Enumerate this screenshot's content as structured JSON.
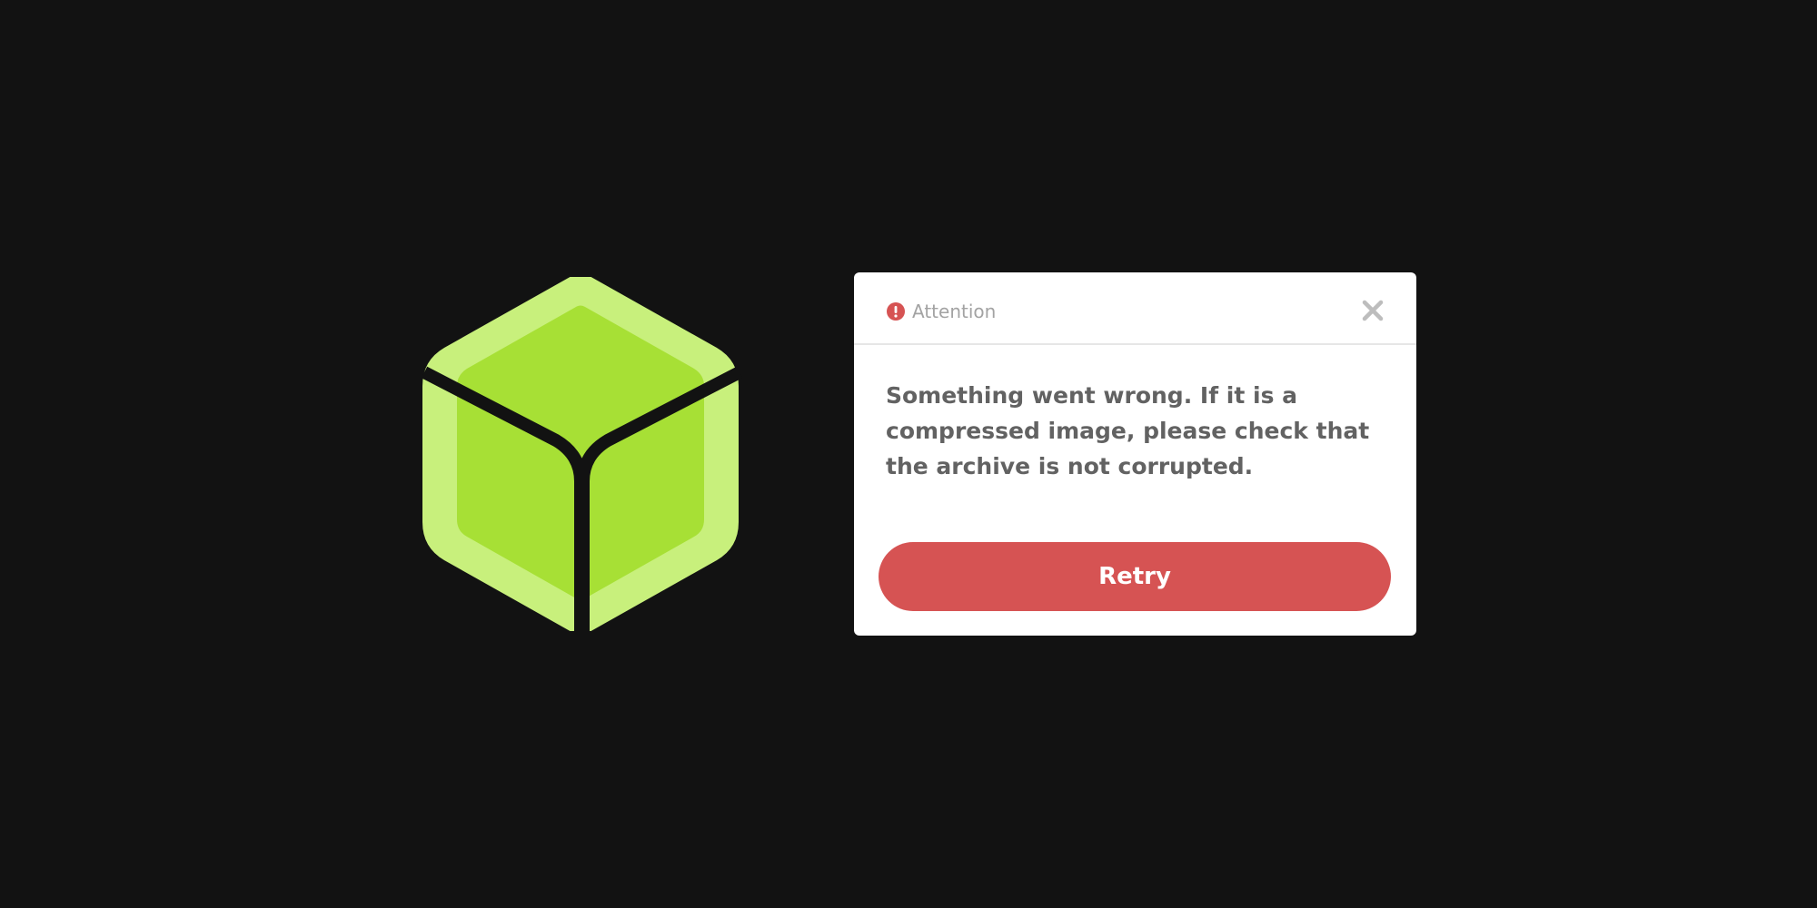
{
  "colors": {
    "background": "#121212",
    "logo_outer": "#c8f07c",
    "logo_inner": "#a7e035",
    "dialog_background": "#ffffff",
    "accent_red": "#d65353",
    "title_text": "#a3a3a3",
    "message_text": "#626262",
    "close_icon": "#bdbdbd"
  },
  "logo": {
    "icon": "cube-logo-icon"
  },
  "dialog": {
    "header": {
      "icon": "exclamation-circle-icon",
      "title": "Attention",
      "close_icon": "close-icon"
    },
    "message": "Something went wrong. If it is a compressed image, please check that the archive is not corrupted.",
    "retry_label": "Retry"
  }
}
